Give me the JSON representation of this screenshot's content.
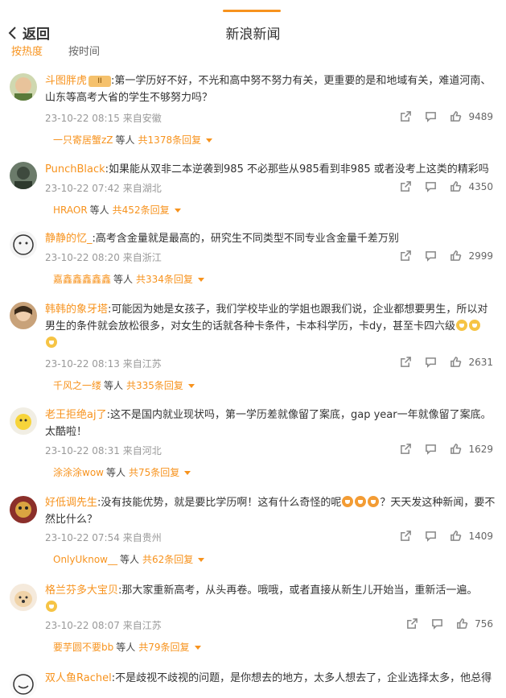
{
  "header": {
    "back_label": "返回",
    "title": "新浪新闻"
  },
  "sort_tabs": [
    {
      "label": "按热度",
      "active": true
    },
    {
      "label": "按时间",
      "active": false
    }
  ],
  "comments": [
    {
      "user": "斗图胖虎",
      "badge": "II",
      "text": ":第一学历好不好，不光和高中努不努力有关，更重要的是和地域有关，难道河南、山东等高考大省的学生不够努力吗？",
      "time": "23-10-22 08:15",
      "location": "来自安徽",
      "likes": "9489",
      "reply_user": "一只寄居蟹zZ",
      "reply_mid": "等人",
      "reply_count": "共1378条回复"
    },
    {
      "user": "PunchBlack",
      "text": ":如果能从双非二本逆袭到985 不必那些从985看到非985 或者没考上这类的精彩吗",
      "time": "23-10-22 07:42",
      "location": "来自湖北",
      "likes": "4350",
      "reply_user": "HRAOR",
      "reply_mid": "等人",
      "reply_count": "共452条回复"
    },
    {
      "user": "静静的忆_",
      "text": ":高考含金量就是最高的，研究生不同类型不同专业含金量千差万别",
      "time": "23-10-22 08:20",
      "location": "来自浙江",
      "likes": "2999",
      "reply_user": "嘉鑫鑫鑫鑫鑫",
      "reply_mid": "等人",
      "reply_count": "共334条回复"
    },
    {
      "user": "韩韩的象牙塔",
      "text": ":可能因为她是女孩子，我们学校毕业的学姐也跟我们说，企业都想要男生，所以对男生的条件就会放松很多，对女生的话就各种卡条件，卡本科学历，卡dy，甚至卡四六级",
      "time": "23-10-22 08:13",
      "location": "来自江苏",
      "likes": "2631",
      "reply_user": "千风之一缕",
      "reply_mid": "等人",
      "reply_count": "共335条回复"
    },
    {
      "user": "老王拒绝aj了",
      "text": ":这不是国内就业现状吗，第一学历差就像留了案底，gap year一年就像留了案底。太酷啦！",
      "time": "23-10-22 08:31",
      "location": "来自河北",
      "likes": "1629",
      "reply_user": "涂涂涂wow",
      "reply_mid": "等人",
      "reply_count": "共75条回复"
    },
    {
      "user": "好低调先生",
      "text": ":没有技能优势，就是要比学历啊！这有什么奇怪的呢",
      "text2": "？天天发这种新闻，要不然比什么？",
      "time": "23-10-22 07:54",
      "location": "来自贵州",
      "likes": "1409",
      "reply_user": "OnlyUknow__",
      "reply_mid": "等人",
      "reply_count": "共62条回复"
    },
    {
      "user": "格兰芬多大宝贝",
      "text": ":那大家重新高考，从头再卷。哦哦，或者直接从新生儿开始当，重新活一遍。",
      "time": "23-10-22 08:07",
      "location": "来自江苏",
      "likes": "756",
      "reply_user": "要芋圆不要bb",
      "reply_mid": "等人",
      "reply_count": "共79条回复"
    },
    {
      "user": "双人鱼Rachel",
      "text": ":不是歧视不歧视的问题，是你想去的地方，太多人想去了，企业选择太多，他总得"
    }
  ],
  "icons": {
    "share": "share-icon",
    "comment": "comment-icon",
    "like": "thumbs-up-icon"
  },
  "colors": {
    "accent": "#f7931e"
  }
}
